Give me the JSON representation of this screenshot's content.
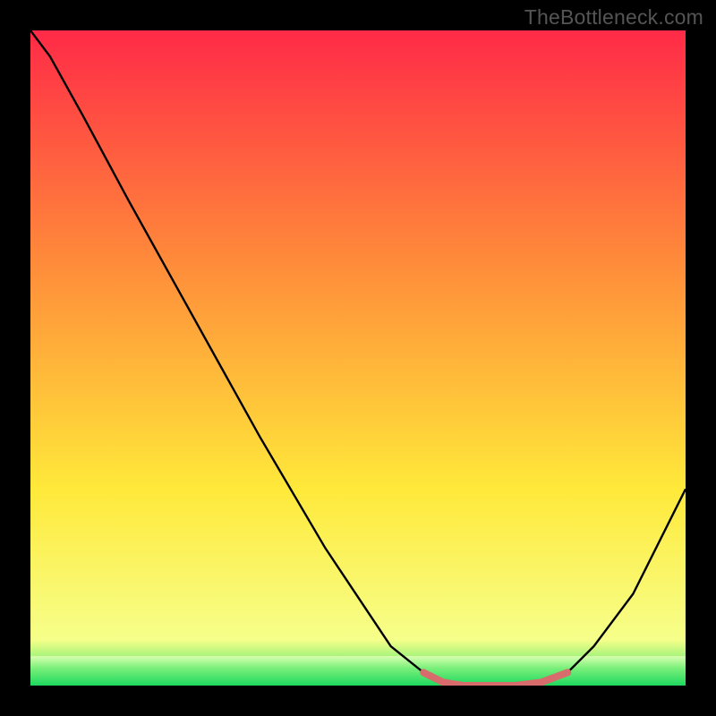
{
  "watermark": "TheBottleneck.com",
  "colors": {
    "gradient_top": "#ff2a47",
    "gradient_mid1": "#ff8a3a",
    "gradient_mid2": "#ffe93a",
    "gradient_bottom": "#20e060",
    "curve": "#000000",
    "highlight": "#d86b6b",
    "highlight_light": "#e98f8a"
  },
  "chart_data": {
    "type": "line",
    "title": "",
    "xlabel": "",
    "ylabel": "",
    "x": [
      0.0,
      0.03,
      0.08,
      0.15,
      0.25,
      0.35,
      0.45,
      0.55,
      0.6,
      0.63,
      0.66,
      0.7,
      0.74,
      0.78,
      0.82,
      0.86,
      0.92,
      1.0
    ],
    "values": [
      1.0,
      0.96,
      0.87,
      0.74,
      0.56,
      0.38,
      0.21,
      0.06,
      0.02,
      0.005,
      0.0,
      0.0,
      0.0,
      0.005,
      0.02,
      0.06,
      0.14,
      0.3
    ],
    "xlim": [
      0,
      1
    ],
    "ylim": [
      0,
      1
    ],
    "highlight_segment": {
      "x": [
        0.6,
        0.63,
        0.66,
        0.7,
        0.74,
        0.78,
        0.82
      ],
      "values": [
        0.02,
        0.005,
        0.0,
        0.0,
        0.0,
        0.005,
        0.02
      ]
    },
    "green_band_y": [
      0.0,
      0.045
    ]
  }
}
